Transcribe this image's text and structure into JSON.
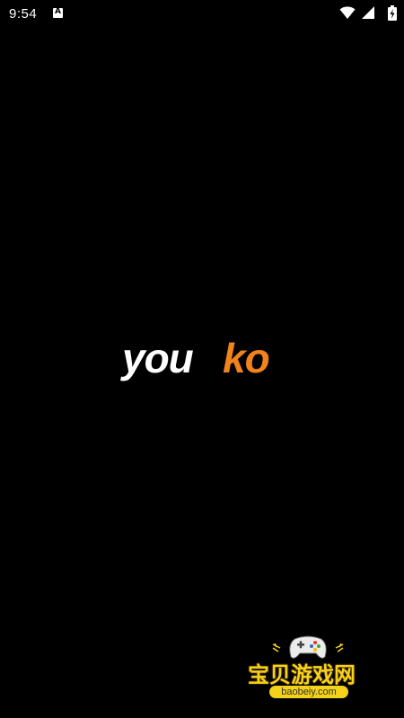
{
  "status_bar": {
    "time": "9:54",
    "notification_icon_letter": "A",
    "icons": [
      "wifi-icon",
      "signal-icon",
      "battery-charging-icon"
    ]
  },
  "splash": {
    "logo_part1": "you",
    "logo_part2": "ko",
    "logo_colors": {
      "part1": "#ffffff",
      "part2": "#f0831c"
    }
  },
  "watermark": {
    "title": "宝贝游戏网",
    "url": "baobeiy.com"
  }
}
